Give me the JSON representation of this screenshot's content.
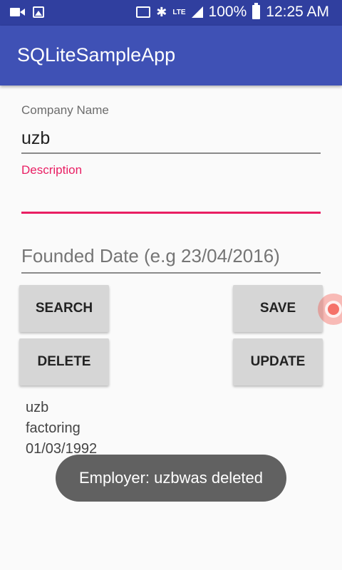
{
  "status_bar": {
    "battery": "100%",
    "time": "12:25 AM",
    "network": "LTE",
    "icons": [
      "video-icon",
      "image-icon",
      "cast-icon",
      "bluetooth-icon",
      "lte-icon",
      "signal-icon",
      "battery-icon"
    ]
  },
  "app_bar": {
    "title": "SQLiteSampleApp"
  },
  "form": {
    "company_name": {
      "label": "Company Name",
      "value": "uzb"
    },
    "description": {
      "label": "Description",
      "value": ""
    },
    "founded_date": {
      "placeholder": "Founded Date (e.g 23/04/2016)",
      "value": ""
    }
  },
  "buttons": {
    "search": "SEARCH",
    "save": "SAVE",
    "delete": "DELETE",
    "update": "UPDATE"
  },
  "record": {
    "name": "uzb",
    "description": "factoring",
    "date": "01/03/1992"
  },
  "toast": {
    "message": "Employer: uzbwas deleted"
  },
  "colors": {
    "primary": "#3f51b5",
    "primary_dark": "#303f9f",
    "accent": "#e91e63"
  }
}
